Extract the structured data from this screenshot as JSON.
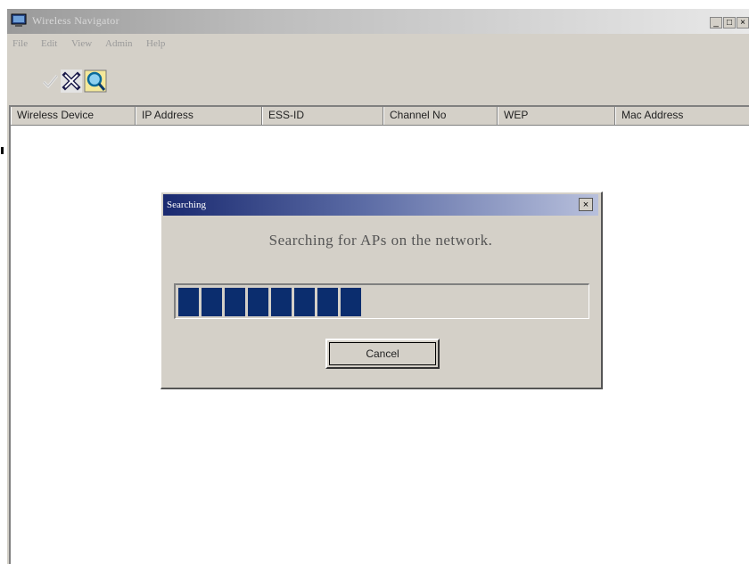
{
  "window": {
    "title": "Wireless Navigator",
    "controls": {
      "minimize": "_",
      "maximize": "□",
      "close": "×"
    }
  },
  "menubar": {
    "items": [
      "File",
      "Edit",
      "View",
      "Admin",
      "Help"
    ]
  },
  "toolbar": {
    "buttons": [
      {
        "icon": "blank-icon"
      },
      {
        "icon": "check-icon"
      },
      {
        "icon": "delete-icon"
      },
      {
        "icon": "search-icon"
      }
    ]
  },
  "list": {
    "columns": [
      "Wireless Device",
      "IP Address",
      "ESS-ID",
      "Channel No",
      "WEP",
      "Mac Address"
    ]
  },
  "dialog": {
    "title": "Searching",
    "close": "×",
    "message": "Searching for APs on the network.",
    "progress_fraction": 0.45,
    "progress_blocks": 8,
    "cancel_label": "Cancel"
  }
}
